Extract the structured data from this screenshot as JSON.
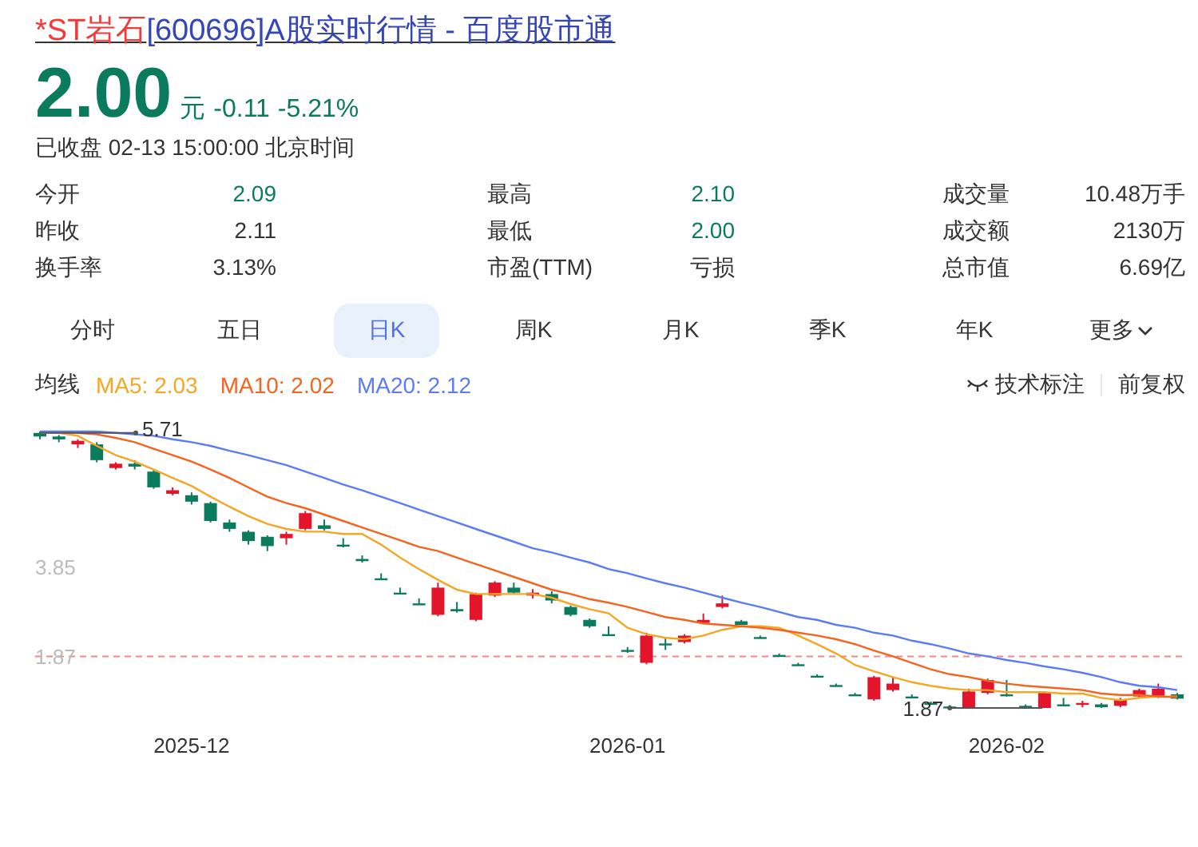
{
  "title": {
    "parts": [
      {
        "text": "*ST岩石",
        "kind": "stock"
      },
      {
        "text": "[600696]A股实时行情 - 百度股市通",
        "kind": "site"
      }
    ]
  },
  "quote": {
    "price": "2.00",
    "unit": "元",
    "change": "-0.11",
    "change_pct": "-5.21%",
    "status": "已收盘 02-13 15:00:00 北京时间"
  },
  "stats": [
    [
      {
        "label": "今开",
        "value": "2.09",
        "color": "#0a7b5c"
      },
      {
        "label": "最高",
        "value": "2.10",
        "color": "#0a7b5c"
      },
      {
        "label": "成交量",
        "value": "10.48万手",
        "color": "#333333"
      }
    ],
    [
      {
        "label": "昨收",
        "value": "2.11",
        "color": "#333333"
      },
      {
        "label": "最低",
        "value": "2.00",
        "color": "#0a7b5c"
      },
      {
        "label": "成交额",
        "value": "2130万",
        "color": "#333333"
      }
    ],
    [
      {
        "label": "换手率",
        "value": "3.13%",
        "color": "#333333"
      },
      {
        "label": "市盈(TTM)",
        "value": "亏损",
        "color": "#333333"
      },
      {
        "label": "总市值",
        "value": "6.69亿",
        "color": "#333333"
      }
    ]
  ],
  "tabs": [
    {
      "label": "分时",
      "selected": false,
      "kind": "plain"
    },
    {
      "label": "五日",
      "selected": false,
      "kind": "plain"
    },
    {
      "label": "日K",
      "selected": true,
      "kind": "plain"
    },
    {
      "label": "周K",
      "selected": false,
      "kind": "plain"
    },
    {
      "label": "月K",
      "selected": false,
      "kind": "plain"
    },
    {
      "label": "季K",
      "selected": false,
      "kind": "plain"
    },
    {
      "label": "年K",
      "selected": false,
      "kind": "plain"
    },
    {
      "label": "更多",
      "selected": false,
      "kind": "dropdown"
    }
  ],
  "indicators": {
    "label": "均线",
    "items": [
      {
        "text": "MA5: 2.03",
        "color": "#f5a623"
      },
      {
        "text": "MA10: 2.02",
        "color": "#f5641e"
      },
      {
        "text": "MA20: 2.12",
        "color": "#5b7cf6"
      }
    ]
  },
  "tools": [
    {
      "text": "技术标注",
      "kind": "icon"
    },
    {
      "text": "前复权",
      "kind": "plain"
    }
  ],
  "chart": {
    "high_label": "5.71",
    "low_label": "1.87",
    "y_labels": [
      "3.85",
      "1.87"
    ],
    "x_labels": [
      "2025-12",
      "2026-01",
      "2026-02"
    ]
  }
}
